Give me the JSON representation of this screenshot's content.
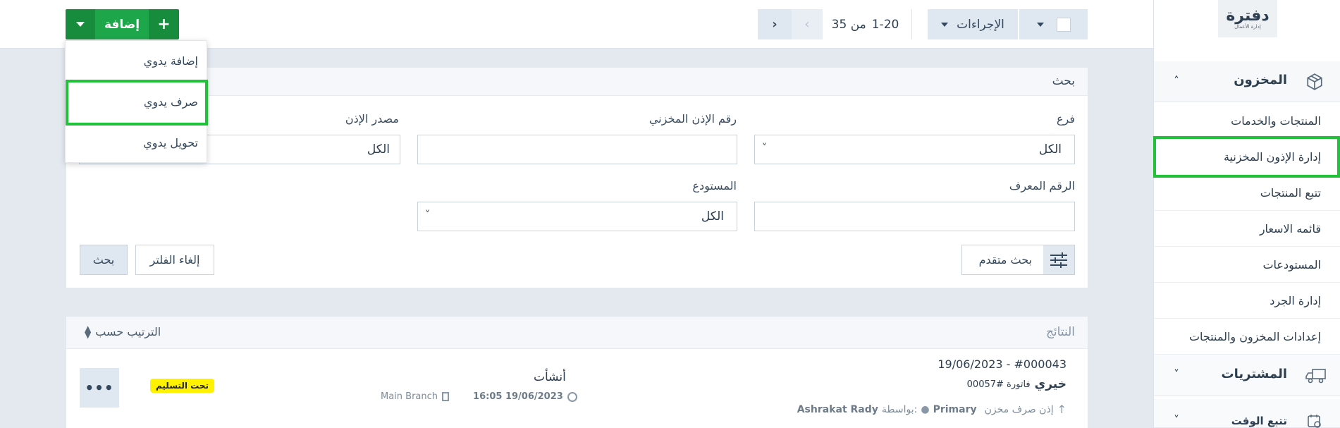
{
  "topbar": {
    "add_label": "إضافة",
    "actions_label": "الإجراءات",
    "pagination_range": "1-20",
    "pagination_of": "من 35"
  },
  "add_menu": {
    "items": [
      {
        "label": "إضافة يدوي"
      },
      {
        "label": "صرف يدوي"
      },
      {
        "label": "تحويل يدوي"
      }
    ]
  },
  "sidebar": {
    "logo_text": "دفترة",
    "logo_sub": "إدارة الأعمال",
    "inventory_title": "المخزون",
    "items": [
      {
        "label": "المنتجات والخدمات"
      },
      {
        "label": "إدارة الإذون المخزنية"
      },
      {
        "label": "تتبع المنتجات"
      },
      {
        "label": "قائمه الاسعار"
      },
      {
        "label": "المستودعات"
      },
      {
        "label": "إدارة الجرد"
      },
      {
        "label": "إعدادات المخزون والمنتجات"
      }
    ],
    "purchases_title": "المشتريات",
    "time_title": "تتبع الوقت"
  },
  "search": {
    "title": "بحث",
    "branch_label": "فرع",
    "branch_value": "الكل",
    "permit_number_label": "رقم الإذن المخزني",
    "permit_source_label": "مصدر الإذن",
    "permit_source_value": "الكل",
    "id_label": "الرقم المعرف",
    "warehouse_label": "المستودع",
    "warehouse_value": "الكل",
    "advanced_label": "بحث متقدم",
    "clear_label": "إلغاء الفلتر",
    "search_label": "بحث"
  },
  "results": {
    "title": "النتائج",
    "sort_label": "الترتيب حسب",
    "row": {
      "number_date": "19/06/2023 - #000043",
      "client": "خيري",
      "invoice": "فاتورة #00057",
      "type_text": "إذن صرف مخزن",
      "warehouse": "Primary",
      "by_label": "بواسطة:",
      "user": "Ashrakat Rady",
      "status_action": "أنشأت",
      "created_at": "16:05 19/06/2023",
      "branch": "Main Branch",
      "badge": "تحت التسليم"
    }
  },
  "colors": {
    "green": "#1ea64b",
    "green_dark": "#188c3d",
    "highlight": "#21c23a",
    "badge_bg": "#fff200"
  }
}
